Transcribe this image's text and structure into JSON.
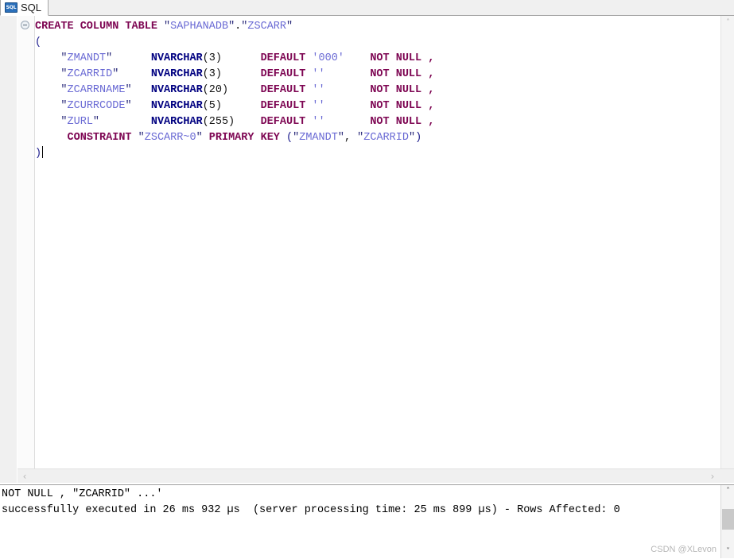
{
  "window": {
    "title": "SQL"
  },
  "tab": {
    "label": "SQL",
    "icon": "sql-icon",
    "icon_text": "SQL"
  },
  "editor": {
    "fold_icon": "collapse-fold-icon",
    "caret_visible": true,
    "lines": [
      {
        "id": 1,
        "indent": "",
        "tokens": [
          {
            "t": "CREATE COLUMN TABLE ",
            "c": "kw"
          },
          {
            "t": "\"",
            "c": "qt"
          },
          {
            "t": "SAPHANADB",
            "c": "idq"
          },
          {
            "t": "\"",
            "c": "qt"
          },
          {
            "t": ".",
            "c": "pn"
          },
          {
            "t": "\"",
            "c": "qt"
          },
          {
            "t": "ZSCARR",
            "c": "idq"
          },
          {
            "t": "\"",
            "c": "qt"
          }
        ]
      },
      {
        "id": 2,
        "indent": "",
        "tokens": [
          {
            "t": "(",
            "c": "paren"
          }
        ]
      },
      {
        "id": 3,
        "indent": "    ",
        "tokens": [
          {
            "t": "\"",
            "c": "qt"
          },
          {
            "t": "ZMANDT",
            "c": "idq"
          },
          {
            "t": "\"",
            "c": "qt"
          },
          {
            "t": "      ",
            "c": "pn"
          },
          {
            "t": "NVARCHAR",
            "c": "typ"
          },
          {
            "t": "(3)",
            "c": "pn"
          },
          {
            "t": "      ",
            "c": "pn"
          },
          {
            "t": "DEFAULT ",
            "c": "kw"
          },
          {
            "t": "'000'",
            "c": "str"
          },
          {
            "t": "    ",
            "c": "pn"
          },
          {
            "t": "NOT NULL ,",
            "c": "kw"
          }
        ]
      },
      {
        "id": 4,
        "indent": "    ",
        "tokens": [
          {
            "t": "\"",
            "c": "qt"
          },
          {
            "t": "ZCARRID",
            "c": "idq"
          },
          {
            "t": "\"",
            "c": "qt"
          },
          {
            "t": "     ",
            "c": "pn"
          },
          {
            "t": "NVARCHAR",
            "c": "typ"
          },
          {
            "t": "(3)",
            "c": "pn"
          },
          {
            "t": "      ",
            "c": "pn"
          },
          {
            "t": "DEFAULT ",
            "c": "kw"
          },
          {
            "t": "''",
            "c": "str"
          },
          {
            "t": "       ",
            "c": "pn"
          },
          {
            "t": "NOT NULL ,",
            "c": "kw"
          }
        ]
      },
      {
        "id": 5,
        "indent": "    ",
        "tokens": [
          {
            "t": "\"",
            "c": "qt"
          },
          {
            "t": "ZCARRNAME",
            "c": "idq"
          },
          {
            "t": "\"",
            "c": "qt"
          },
          {
            "t": "   ",
            "c": "pn"
          },
          {
            "t": "NVARCHAR",
            "c": "typ"
          },
          {
            "t": "(20)",
            "c": "pn"
          },
          {
            "t": "     ",
            "c": "pn"
          },
          {
            "t": "DEFAULT ",
            "c": "kw"
          },
          {
            "t": "''",
            "c": "str"
          },
          {
            "t": "       ",
            "c": "pn"
          },
          {
            "t": "NOT NULL ,",
            "c": "kw"
          }
        ]
      },
      {
        "id": 6,
        "indent": "    ",
        "tokens": [
          {
            "t": "\"",
            "c": "qt"
          },
          {
            "t": "ZCURRCODE",
            "c": "idq"
          },
          {
            "t": "\"",
            "c": "qt"
          },
          {
            "t": "   ",
            "c": "pn"
          },
          {
            "t": "NVARCHAR",
            "c": "typ"
          },
          {
            "t": "(5)",
            "c": "pn"
          },
          {
            "t": "      ",
            "c": "pn"
          },
          {
            "t": "DEFAULT ",
            "c": "kw"
          },
          {
            "t": "''",
            "c": "str"
          },
          {
            "t": "       ",
            "c": "pn"
          },
          {
            "t": "NOT NULL ,",
            "c": "kw"
          }
        ]
      },
      {
        "id": 7,
        "indent": "    ",
        "tokens": [
          {
            "t": "\"",
            "c": "qt"
          },
          {
            "t": "ZURL",
            "c": "idq"
          },
          {
            "t": "\"",
            "c": "qt"
          },
          {
            "t": "        ",
            "c": "pn"
          },
          {
            "t": "NVARCHAR",
            "c": "typ"
          },
          {
            "t": "(255)",
            "c": "pn"
          },
          {
            "t": "    ",
            "c": "pn"
          },
          {
            "t": "DEFAULT ",
            "c": "kw"
          },
          {
            "t": "''",
            "c": "str"
          },
          {
            "t": "       ",
            "c": "pn"
          },
          {
            "t": "NOT NULL ,",
            "c": "kw"
          }
        ]
      },
      {
        "id": 8,
        "indent": "     ",
        "tokens": [
          {
            "t": "CONSTRAINT ",
            "c": "kw"
          },
          {
            "t": "\"",
            "c": "qt"
          },
          {
            "t": "ZSCARR~0",
            "c": "idq"
          },
          {
            "t": "\"",
            "c": "qt"
          },
          {
            "t": " ",
            "c": "pn"
          },
          {
            "t": "PRIMARY KEY ",
            "c": "kw"
          },
          {
            "t": "(",
            "c": "paren"
          },
          {
            "t": "\"",
            "c": "qt"
          },
          {
            "t": "ZMANDT",
            "c": "idq"
          },
          {
            "t": "\"",
            "c": "qt"
          },
          {
            "t": ", ",
            "c": "pn"
          },
          {
            "t": "\"",
            "c": "qt"
          },
          {
            "t": "ZCARRID",
            "c": "idq"
          },
          {
            "t": "\"",
            "c": "qt"
          },
          {
            "t": ")",
            "c": "paren"
          }
        ]
      },
      {
        "id": 9,
        "indent": "",
        "tokens": [
          {
            "t": ")",
            "c": "paren"
          }
        ]
      }
    ]
  },
  "scrollbars": {
    "editor_vertical_up": "˄",
    "editor_vertical_down": "˅",
    "editor_horizontal_left": "‹",
    "editor_horizontal_right": "›",
    "console_up": "˄",
    "console_down": "˅"
  },
  "console": {
    "lines": [
      "NOT NULL , \"ZCARRID\" ...'",
      "successfully executed in 26 ms 932 µs  (server processing time: 25 ms 899 µs) - Rows Affected: 0"
    ],
    "status": "successfully executed",
    "duration": "26 ms 932 µs",
    "server_processing_time": "25 ms 899 µs",
    "rows_affected": "0"
  },
  "watermark": {
    "text": "CSDN @XLevon"
  },
  "colors": {
    "keyword": "#7d0552",
    "type": "#000080",
    "identifier": "#6a6ad4",
    "string": "#6a6ad4",
    "plain": "#111111",
    "tab_icon_bg": "#2a6fba",
    "panel_bg": "#f0f0f0",
    "background": "#ffffff"
  }
}
